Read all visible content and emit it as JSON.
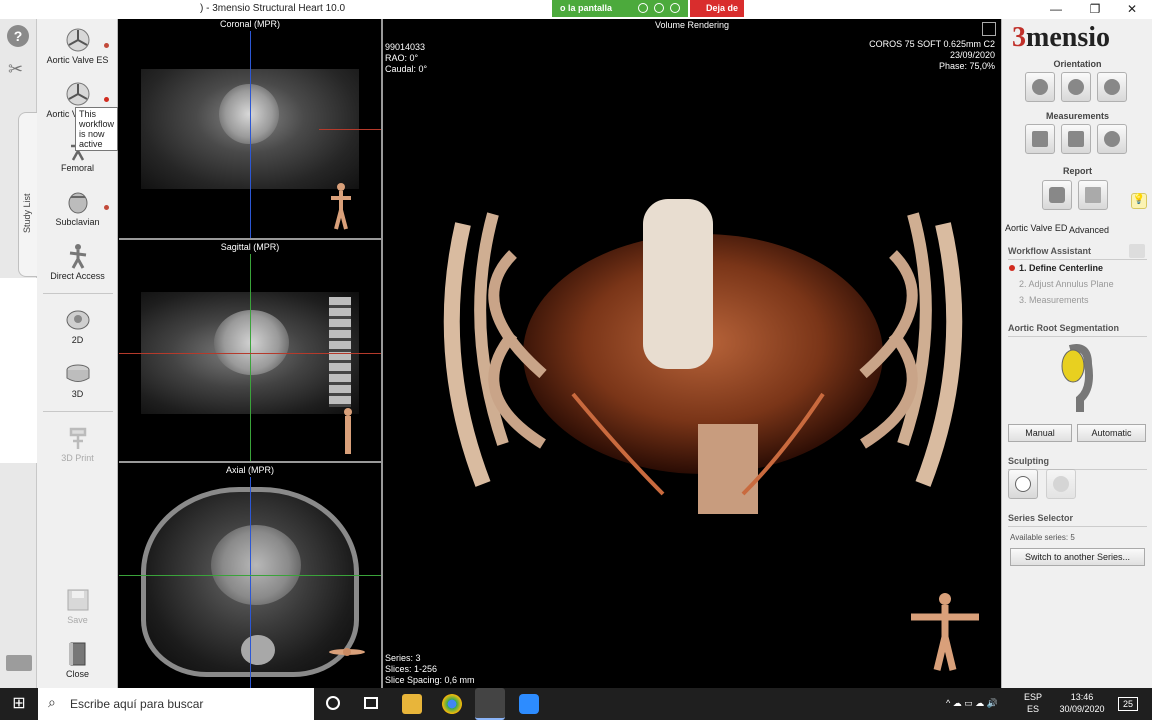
{
  "window": {
    "title": ") - 3mensio Structural Heart 10.0",
    "share_label": "o la pantalla",
    "stop_label": "Deja de",
    "min": "—",
    "max": "❐",
    "close": "✕"
  },
  "left_toolbar": {
    "help": "?",
    "study_tab": "Study List"
  },
  "workflows": {
    "items": [
      {
        "label": "Aortic Valve ES"
      },
      {
        "label": "Aortic Valve ED"
      },
      {
        "label": "Femoral"
      },
      {
        "label": "Subclavian"
      },
      {
        "label": "Direct Access"
      }
    ],
    "tooltip": "This workflow is now active",
    "view_2d": "2D",
    "view_3d": "3D",
    "print_3d": "3D Print",
    "save": "Save",
    "close": "Close"
  },
  "mpr": {
    "coronal": "Coronal (MPR)",
    "sagittal": "Sagittal (MPR)",
    "axial": "Axial (MPR)"
  },
  "main_view": {
    "title": "Volume Rendering",
    "top_left": [
      "99014033",
      "RAO: 0°",
      "Caudal: 0°"
    ],
    "top_right": [
      "COROS 75 SOFT 0.625mm C2",
      "23/09/2020",
      "Phase: 75,0%"
    ],
    "bottom_left": [
      "Series: 3",
      "Slices: 1-256",
      "Slice Spacing: 0,6 mm"
    ]
  },
  "right_panel": {
    "logo_num": "3",
    "logo_text": "mensio",
    "orientation": "Orientation",
    "measurements": "Measurements",
    "report": "Report",
    "tab_active": "Aortic Valve ED",
    "tab_other": "Advanced",
    "workflow_assistant": "Workflow Assistant",
    "steps": [
      "1. Define Centerline",
      "2. Adjust Annulus Plane",
      "3. Measurements"
    ],
    "segmentation": "Aortic Root Segmentation",
    "manual": "Manual",
    "automatic": "Automatic",
    "sculpting": "Sculpting",
    "series_selector": "Series Selector",
    "available_series": "Available series: 5",
    "switch_series": "Switch to another Series..."
  },
  "taskbar": {
    "search_placeholder": "Escribe aquí para buscar",
    "lang1": "ESP",
    "lang2": "ES",
    "time": "13:46",
    "date": "30/09/2020",
    "notifications": "25"
  }
}
